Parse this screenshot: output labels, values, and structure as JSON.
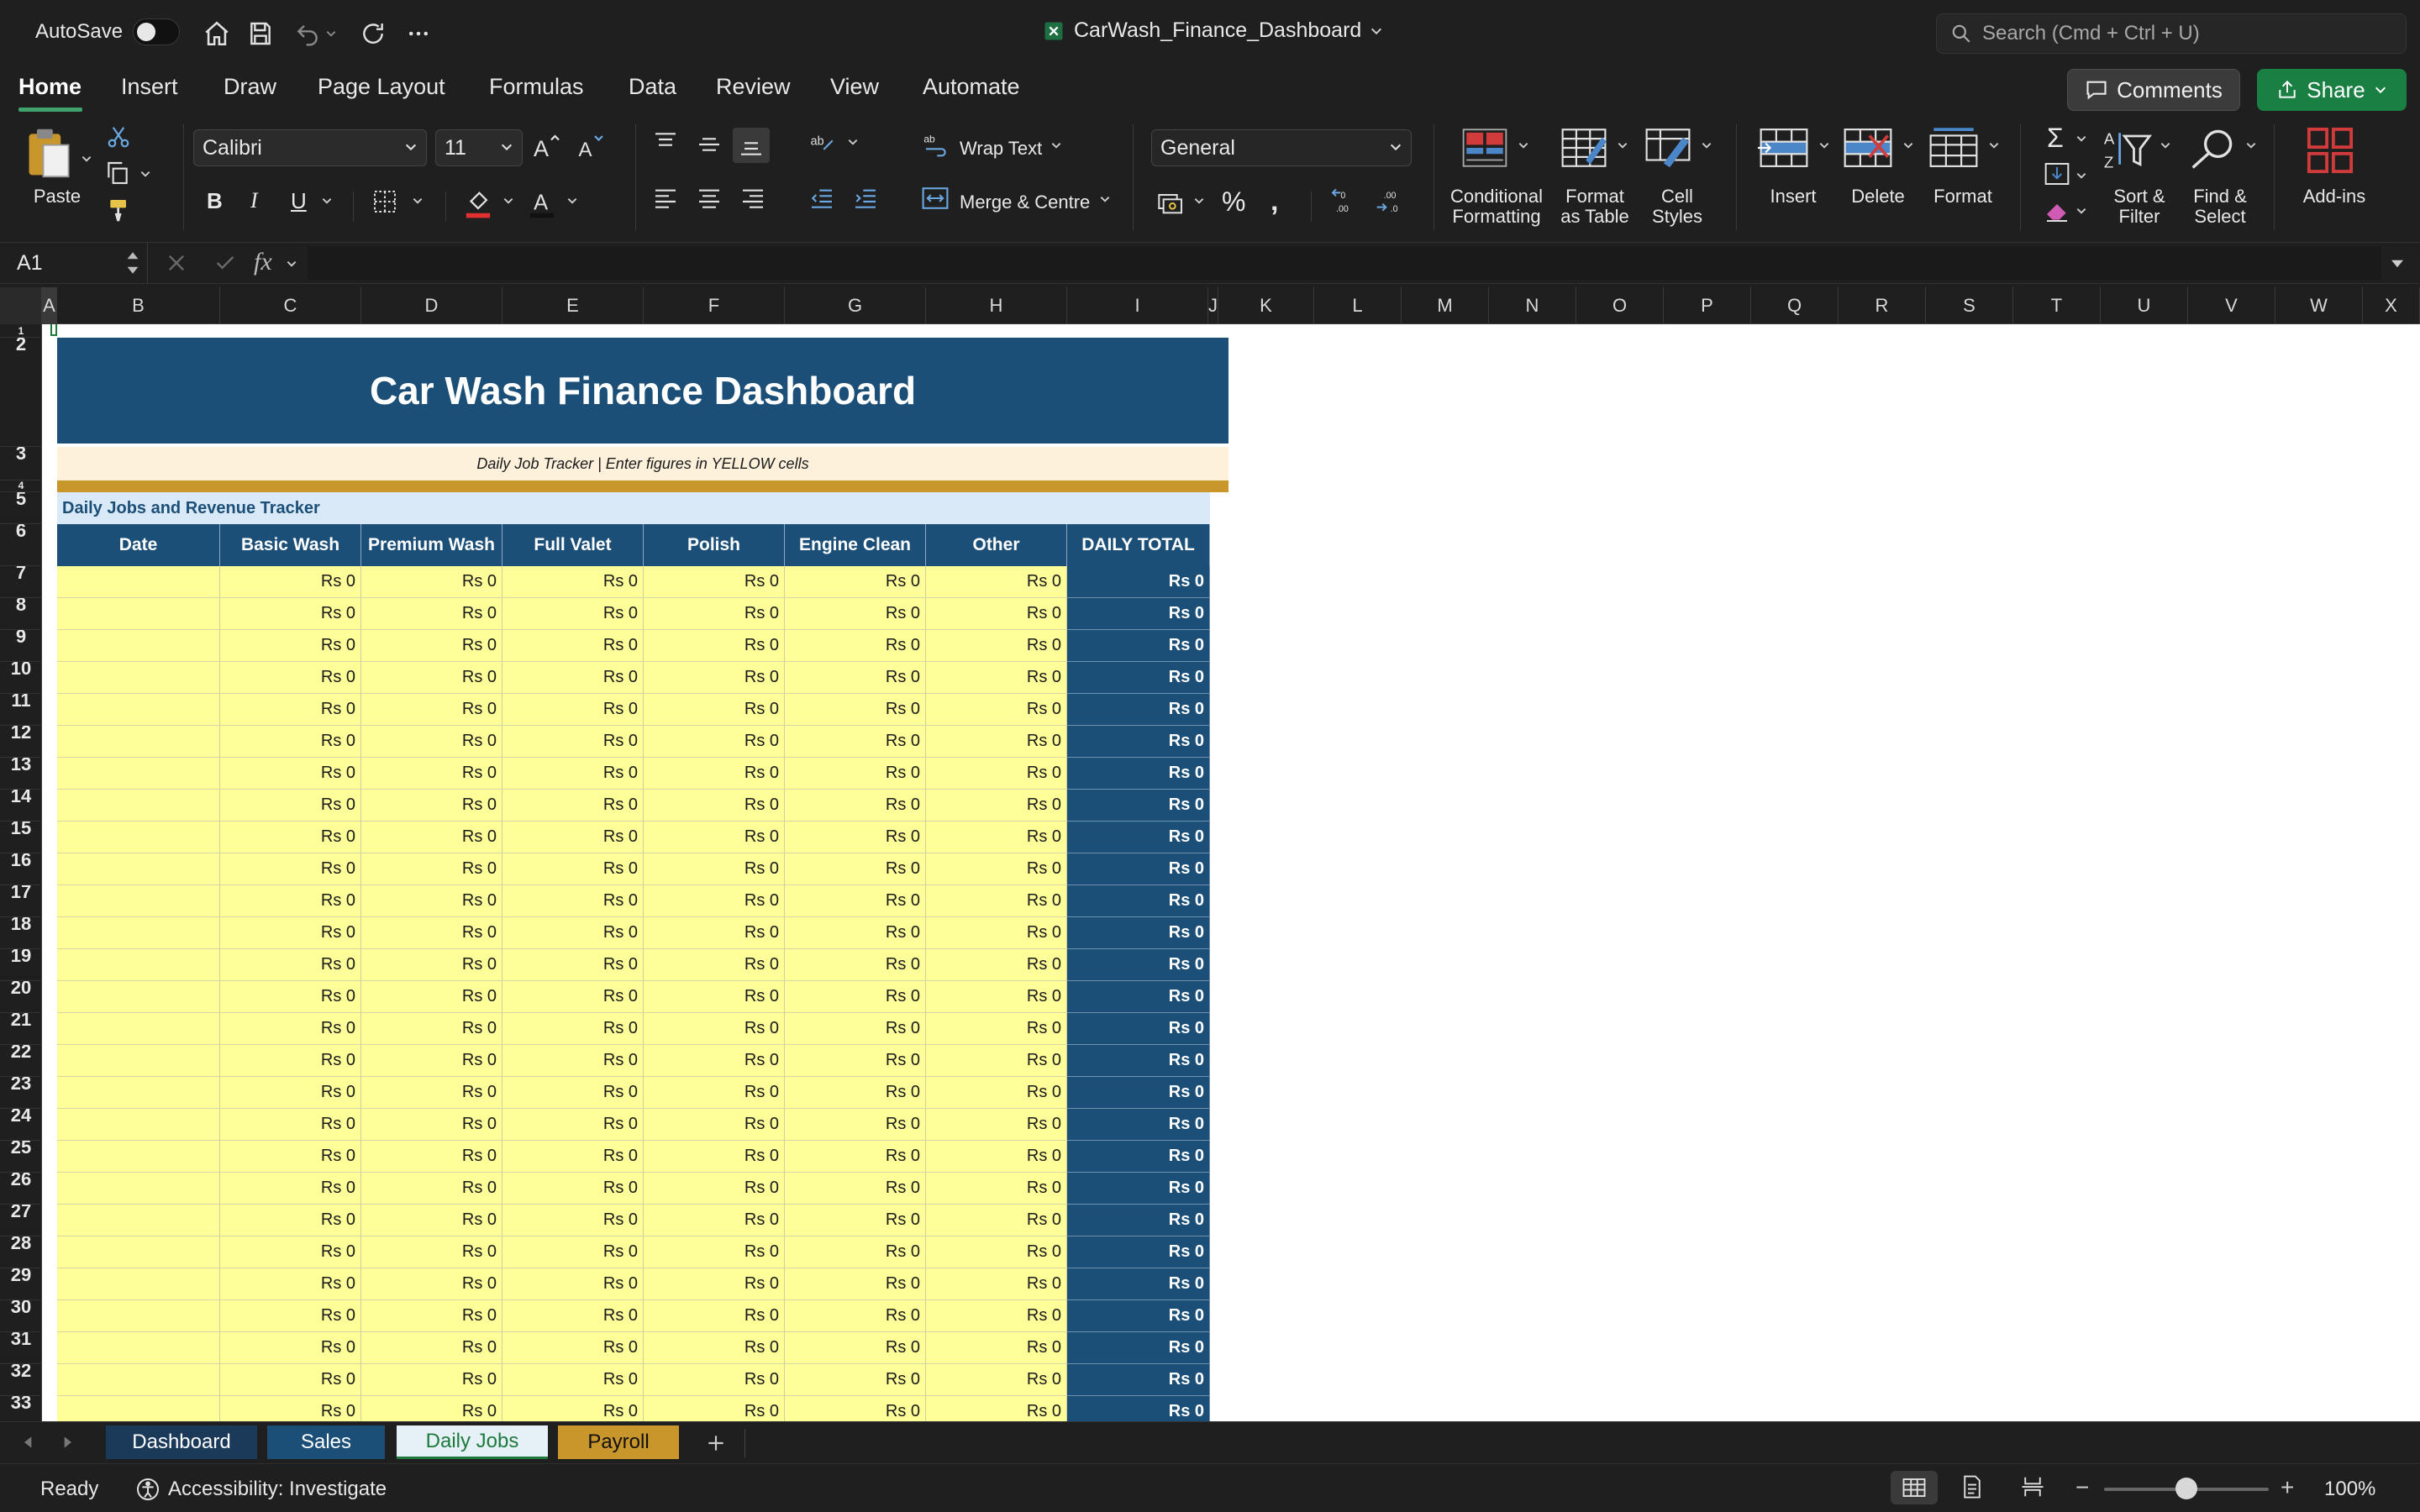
{
  "titlebar": {
    "autosave_label": "AutoSave",
    "doc_title": "CarWash_Finance_Dashboard",
    "search_placeholder": "Search (Cmd + Ctrl + U)"
  },
  "menu_tabs": [
    "Home",
    "Insert",
    "Draw",
    "Page Layout",
    "Formulas",
    "Data",
    "Review",
    "View",
    "Automate"
  ],
  "comments_label": "Comments",
  "share_label": "Share",
  "ribbon": {
    "paste": "Paste",
    "font_name": "Calibri",
    "font_size": "11",
    "wrap_text": "Wrap Text",
    "merge_centre": "Merge & Centre",
    "number_format": "General",
    "conditional_formatting": [
      "Conditional",
      "Formatting"
    ],
    "format_as_table": [
      "Format",
      "as Table"
    ],
    "cell_styles": [
      "Cell",
      "Styles"
    ],
    "insert": "Insert",
    "delete": "Delete",
    "format": "Format",
    "sort_filter": [
      "Sort &",
      "Filter"
    ],
    "find_select": [
      "Find &",
      "Select"
    ],
    "add_ins": "Add-ins"
  },
  "formula_bar": {
    "name_box": "A1",
    "formula": ""
  },
  "columns": [
    "A",
    "B",
    "C",
    "D",
    "E",
    "F",
    "G",
    "H",
    "I",
    "J",
    "K",
    "L",
    "M",
    "N",
    "O",
    "P",
    "Q",
    "R",
    "S",
    "T",
    "U",
    "V",
    "W",
    "X"
  ],
  "sheet": {
    "title": "Car Wash Finance Dashboard",
    "subtitle": "Daily Job Tracker  |  Enter figures in YELLOW cells",
    "section_header": "Daily Jobs and Revenue Tracker",
    "headers": [
      "Date",
      "Basic Wash",
      "Premium Wash",
      "Full Valet",
      "Polish",
      "Engine Clean",
      "Other",
      "DAILY TOTAL"
    ],
    "first_data_row": 7,
    "last_row_label": 33,
    "cell_value": "Rs 0",
    "total_value": "Rs 0"
  },
  "sheet_tabs": [
    {
      "label": "Dashboard",
      "bg": "#1b3a5a",
      "color": "#ffffff"
    },
    {
      "label": "Sales",
      "bg": "#1b4f78",
      "color": "#ffffff"
    },
    {
      "label": "Daily Jobs",
      "bg": "#e6f0f7",
      "color": "#1e7a3c"
    },
    {
      "label": "Payroll",
      "bg": "#c9962b",
      "color": "#111111"
    }
  ],
  "statusbar": {
    "ready": "Ready",
    "accessibility": "Accessibility: Investigate",
    "zoom": "100%",
    "zoom_fraction": 0.5
  },
  "colors": {
    "header_blue": "#1b4f78",
    "input_yellow": "#ffff99",
    "gold": "#c9962b",
    "share_green": "#1a7f43"
  }
}
